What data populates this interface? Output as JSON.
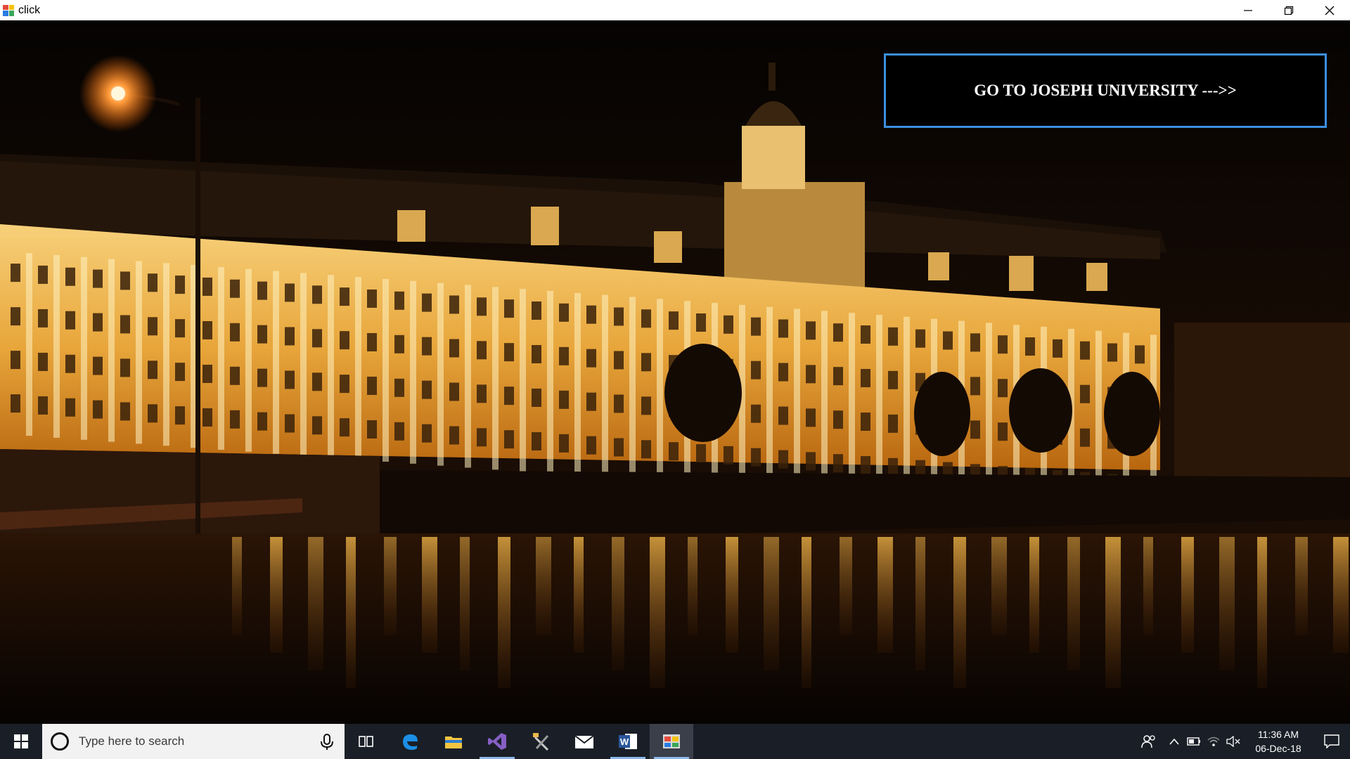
{
  "window": {
    "title": "click",
    "app_icon": "app-window-icon"
  },
  "main": {
    "button_label": "GO TO JOSEPH UNIVERSITY --->>",
    "background_image": "university-building-at-night-photo"
  },
  "taskbar": {
    "search_placeholder": "Type here to search",
    "pinned": [
      "task-view-icon",
      "edge-icon",
      "file-explorer-icon",
      "visual-studio-icon",
      "tools-icon",
      "mail-icon",
      "word-icon",
      "click-app-icon"
    ],
    "clock_time": "11:36 AM",
    "clock_date": "06-Dec-18"
  },
  "colors": {
    "button_border": "#3b8fe0",
    "taskbar_bg": "#1a1f27",
    "building_light": "#f2c46a"
  }
}
